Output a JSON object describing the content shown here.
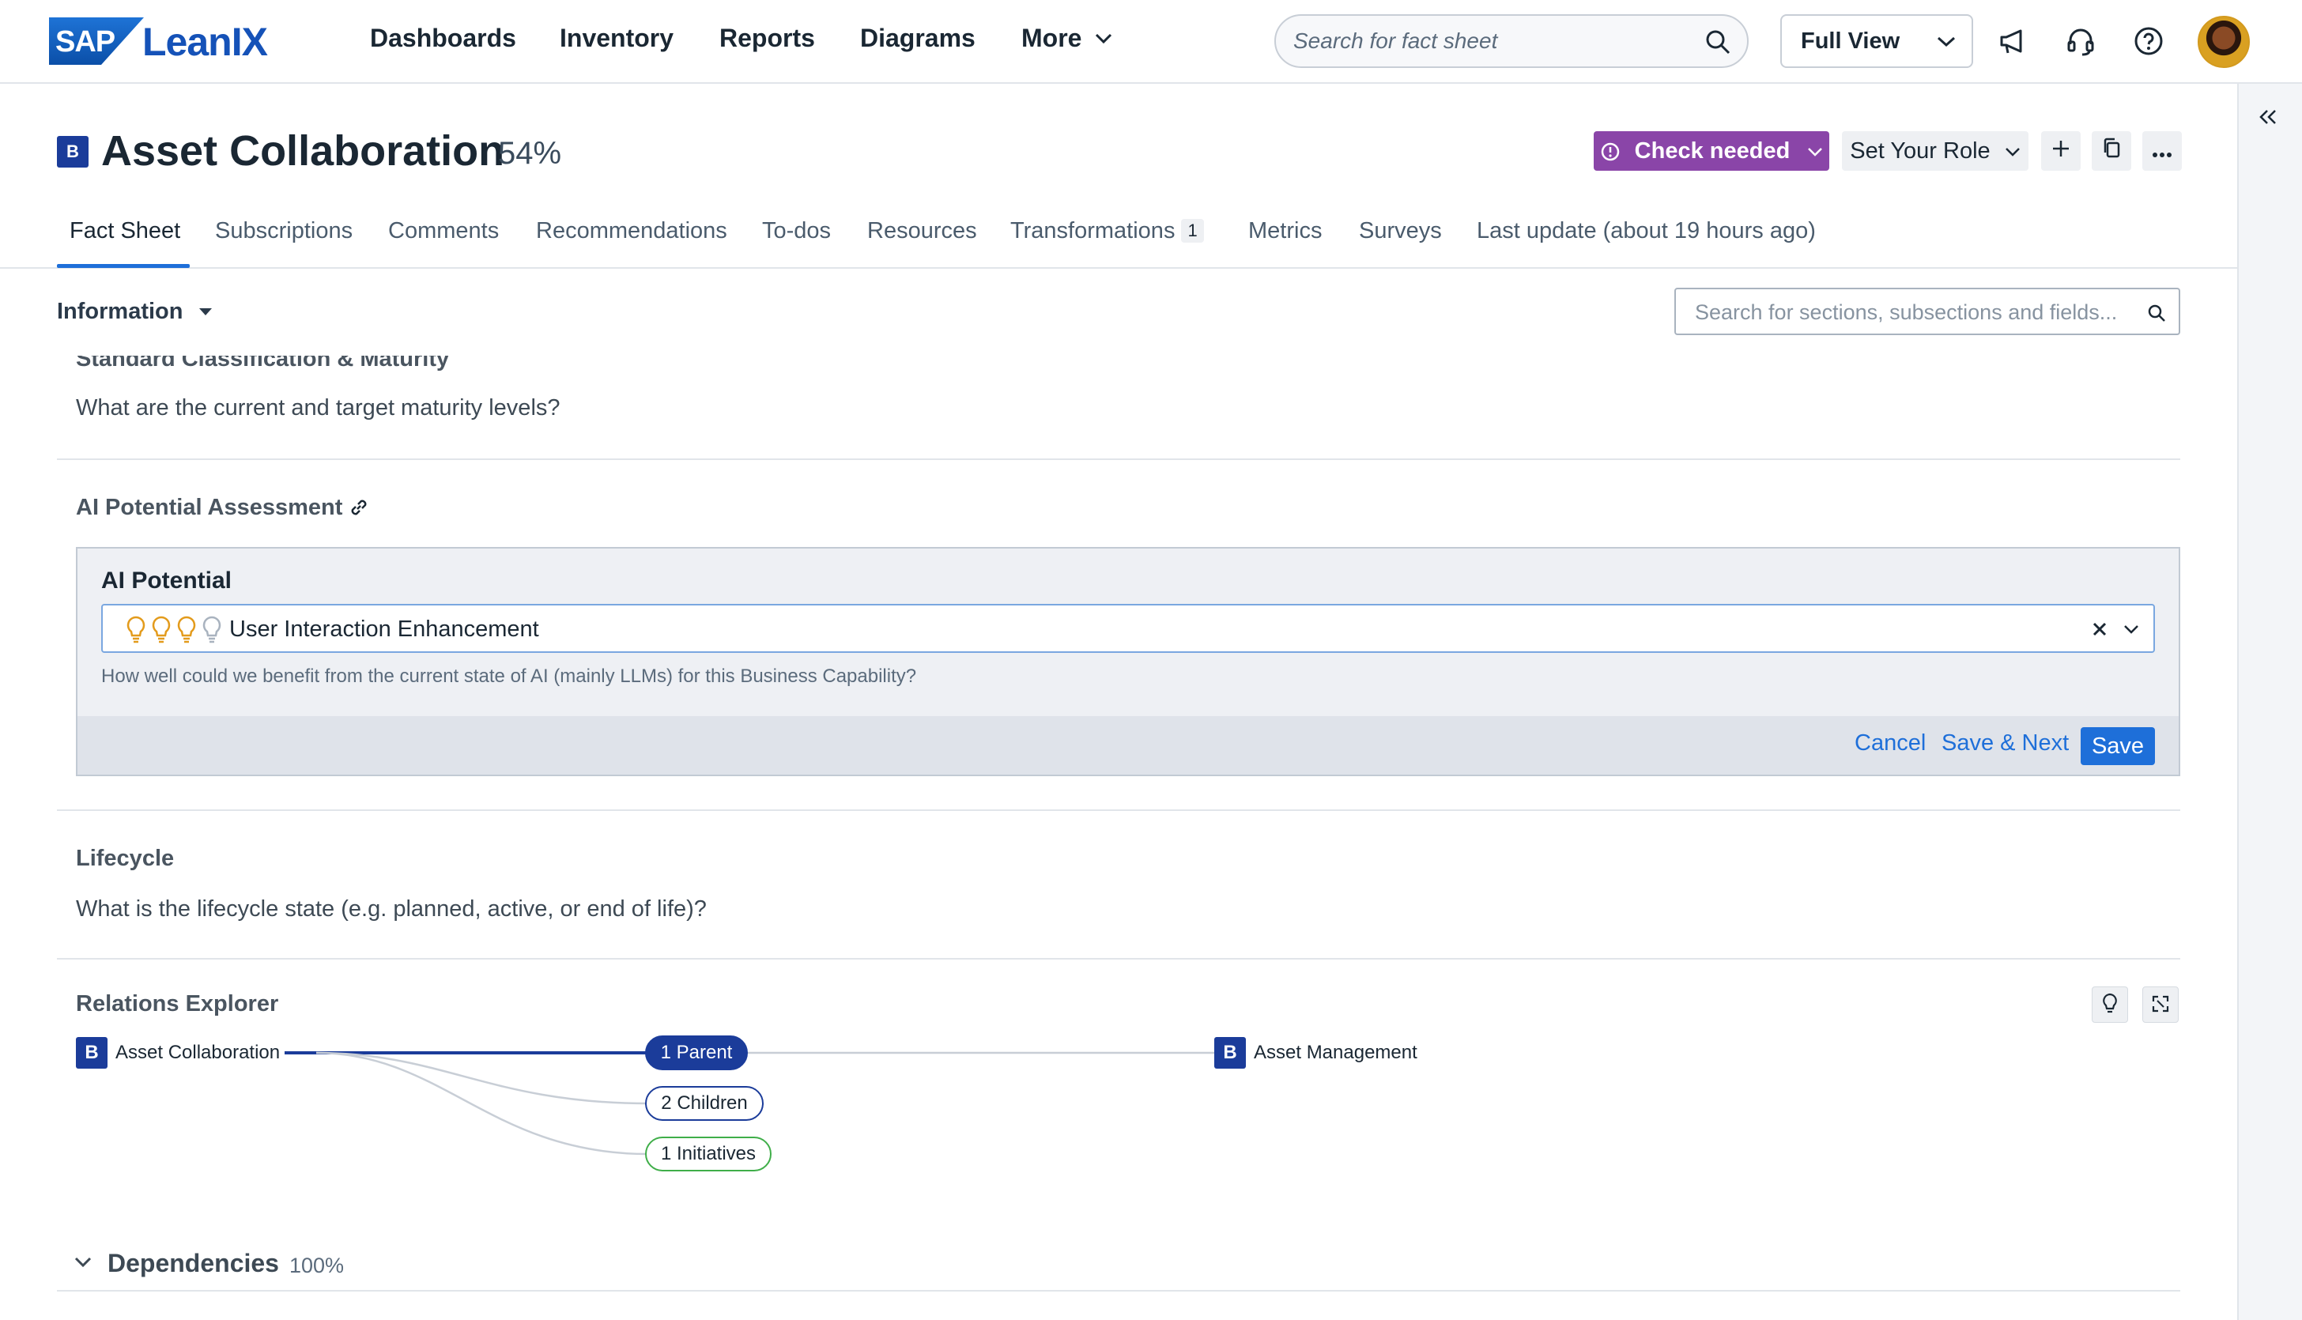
{
  "app": {
    "brand_sap": "SAP",
    "brand_name": "LeanIX",
    "nav": [
      "Dashboards",
      "Inventory",
      "Reports",
      "Diagrams",
      "More"
    ],
    "search_placeholder": "Search for fact sheet",
    "view_label": "Full View"
  },
  "factsheet": {
    "type_badge": "B",
    "title": "Asset Collaboration",
    "completion": "54%",
    "status_button": "Check needed",
    "role_button": "Set Your Role"
  },
  "tabs": [
    {
      "label": "Fact Sheet",
      "active": true
    },
    {
      "label": "Subscriptions"
    },
    {
      "label": "Comments"
    },
    {
      "label": "Recommendations"
    },
    {
      "label": "To-dos"
    },
    {
      "label": "Resources"
    },
    {
      "label": "Transformations",
      "count": "1"
    },
    {
      "label": "Metrics"
    },
    {
      "label": "Surveys"
    },
    {
      "label": "Last update (about 19 hours ago)"
    }
  ],
  "info_bar": {
    "dropdown_label": "Information",
    "section_search_placeholder": "Search for sections, subsections and fields..."
  },
  "sections": {
    "maturity": {
      "title": "Standard Classification & Maturity",
      "question": "What are the current and target maturity levels?"
    },
    "ai_assessment": {
      "title": "AI Potential Assessment",
      "field_label": "AI Potential",
      "selected_value": "User Interaction Enhancement",
      "rating_filled": 3,
      "rating_max": 4,
      "help_text": "How well could we benefit from the current state of AI (mainly LLMs) for this Business Capability?",
      "cancel_label": "Cancel",
      "save_next_label": "Save & Next",
      "save_label": "Save"
    },
    "lifecycle": {
      "title": "Lifecycle",
      "question": "What is the lifecycle state (e.g. planned, active, or end of life)?"
    },
    "relations": {
      "title": "Relations Explorer",
      "source": {
        "badge": "B",
        "label": "Asset Collaboration"
      },
      "relations": [
        {
          "label": "1 Parent",
          "style": "filled"
        },
        {
          "label": "2 Children",
          "style": "outline-blue"
        },
        {
          "label": "1 Initiatives",
          "style": "outline-green"
        }
      ],
      "target": {
        "badge": "B",
        "label": "Asset Management"
      }
    },
    "dependencies": {
      "title": "Dependencies",
      "completion": "100%"
    }
  },
  "colors": {
    "accent": "#1e6fd9",
    "factsheet_badge": "#1b3c9a",
    "check_needed": "#8a45a8",
    "initiative_green": "#3fae49"
  }
}
